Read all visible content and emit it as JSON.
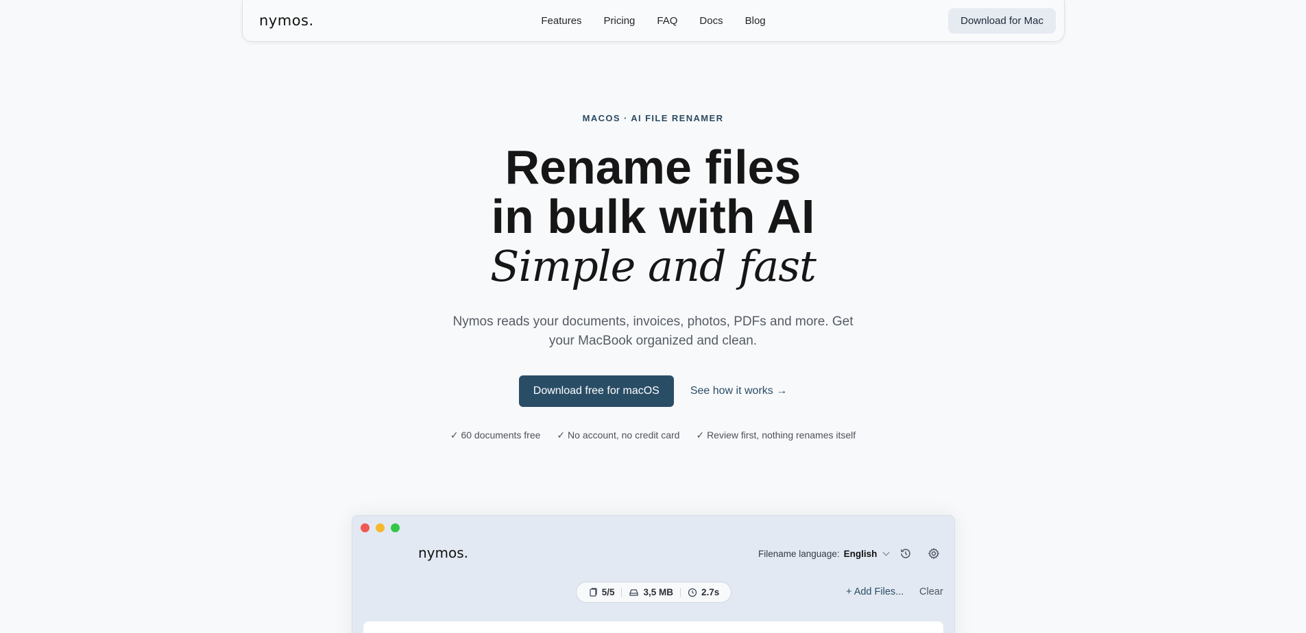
{
  "nav": {
    "logo": "nymos.",
    "links": [
      "Features",
      "Pricing",
      "FAQ",
      "Docs",
      "Blog"
    ],
    "cta": "Download for Mac"
  },
  "hero": {
    "eyebrow": "MACOS · AI FILE RENAMER",
    "title_line1": "Rename files",
    "title_line2": "in bulk with AI",
    "title_script": "Simple and fast",
    "subtitle": "Nymos reads your documents, invoices, photos, PDFs and more. Get your MacBook organized and clean.",
    "primary_cta": "Download free for macOS",
    "secondary_cta": "See how it works →",
    "checks": [
      "✓ 60 documents free",
      "✓ No account, no credit card",
      "✓ Review first, nothing renames itself"
    ]
  },
  "app_window": {
    "logo": "nymos.",
    "language_label": "Filename language:",
    "language_value": "English",
    "icons": [
      "history-icon",
      "settings-gear-icon"
    ],
    "stats": {
      "files": "5/5",
      "size": "3,5 MB",
      "time": "2.7s"
    },
    "add_files": "+ Add Files...",
    "clear": "Clear"
  },
  "colors": {
    "accent": "#2a4d66",
    "background": "#f8f9fb",
    "window_bg": "#e3e9f2"
  }
}
